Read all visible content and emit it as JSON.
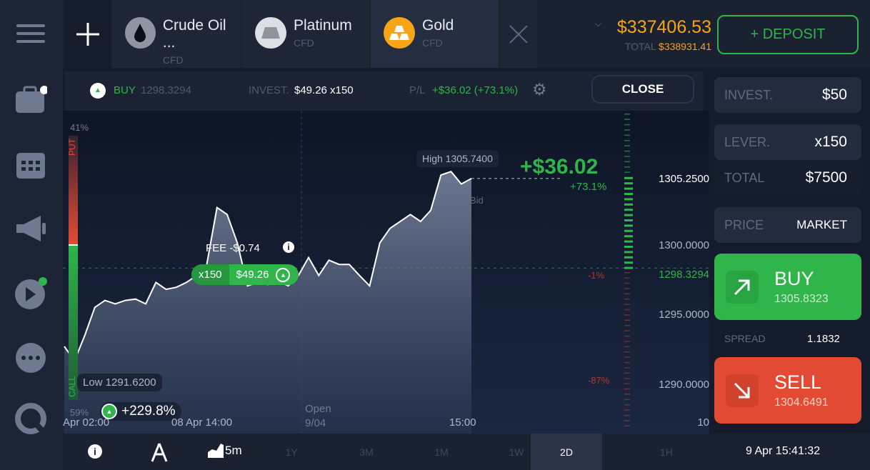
{
  "sidebar": {
    "items": [
      {
        "icon": "menu-icon"
      },
      {
        "icon": "portfolio-icon"
      },
      {
        "icon": "calendar-icon"
      },
      {
        "icon": "megaphone-icon"
      },
      {
        "icon": "video-icon"
      },
      {
        "icon": "chat-icon"
      },
      {
        "icon": "support-icon"
      }
    ]
  },
  "tabs": [
    {
      "name": "Crude Oil ...",
      "sub": "CFD",
      "icon": "oil-drop-icon"
    },
    {
      "name": "Platinum",
      "sub": "CFD",
      "icon": "platinum-bar-icon"
    },
    {
      "name": "Gold",
      "sub": "CFD",
      "icon": "gold-bars-icon",
      "active": true
    }
  ],
  "account": {
    "balance": "$337406.53",
    "total_label": "TOTAL",
    "total": "$338931.41",
    "deposit": "+ DEPOSIT"
  },
  "position": {
    "side": "BUY",
    "price": "1298.3294",
    "invest_label": "INVEST.",
    "invest": "$49.26 x150",
    "pl_label": "P/L",
    "pl": "+$36.02 (+73.1%)",
    "close": "CLOSE"
  },
  "chart": {
    "high_label": "High 1305.7400",
    "low_label": "Low 1291.6200",
    "profit": "+$36.02",
    "profit_pct": "+73.1%",
    "bid": "Bid",
    "fee": "FEE -$0.74",
    "badge_mult": "x150",
    "badge_amount": "$49.26",
    "sentiment_put": "PUT",
    "sentiment_call": "CALL",
    "put_pct": "41%",
    "call_pct": "59%",
    "call_fraction": 0.59,
    "trade_gain": "+229.8%",
    "y_ticks": [
      "1305.2500",
      "1300.0000",
      "1295.0000",
      "1290.0000"
    ],
    "current_open": "1298.3294",
    "pct_minus1": "-1%",
    "pct_minus87": "-87%",
    "volume_label": "10",
    "x_ticks": [
      "Apr 02:00",
      "08 Apr 14:00",
      "Open\n9/04",
      "15:00"
    ],
    "prices": [
      1292.68,
      1291.65,
      1293.45,
      1295.5,
      1296.0,
      1295.75,
      1296.0,
      1296.1,
      1295.75,
      1297.3,
      1296.8,
      1296.95,
      1297.3,
      1297.8,
      1298.6,
      1302.7,
      1302.2,
      1300.15,
      1297.05,
      1297.3,
      1297.15,
      1297.4,
      1297.05,
      1297.8,
      1299.1,
      1297.8,
      1298.9,
      1298.6,
      1298.6,
      1297.8,
      1297.05,
      1300.15,
      1301.2,
      1301.7,
      1302.2,
      1301.7,
      1302.5,
      1305.05,
      1305.3,
      1304.4,
      1304.8
    ],
    "colors": {
      "up": "#2fb54a",
      "down": "#e24a33"
    }
  },
  "order": {
    "invest_label": "INVEST.",
    "invest": "$50",
    "lever_label": "LEVER.",
    "lever": "x150",
    "total_label": "TOTAL",
    "total": "$7500",
    "price_label": "PRICE",
    "price": "MARKET",
    "buy": "BUY",
    "buy_price": "1305.8323",
    "spread_label": "SPREAD",
    "spread": "1.1832",
    "sell": "SELL",
    "sell_price": "1304.6491"
  },
  "bottom": {
    "interval": "5m",
    "periods": [
      "1Y",
      "3M",
      "1M",
      "1W",
      "2D",
      "1H"
    ],
    "active_period": "2D",
    "datetime": "9 Apr 15:41:32"
  }
}
